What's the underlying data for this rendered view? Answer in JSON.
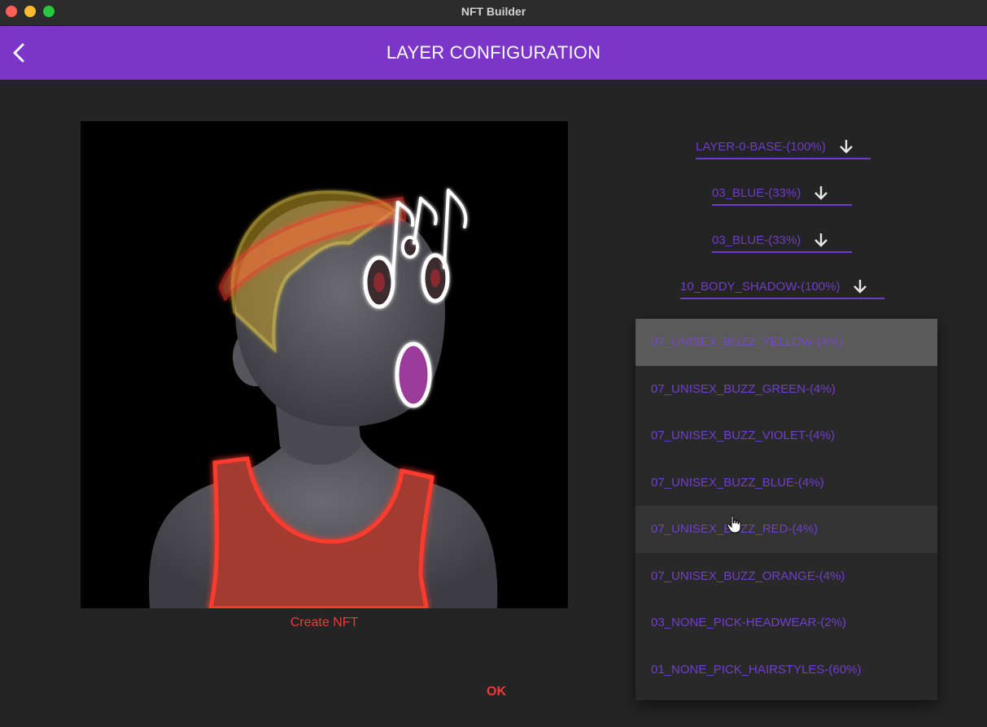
{
  "window": {
    "title": "NFT Builder"
  },
  "appbar": {
    "title": "LAYER CONFIGURATION",
    "back_icon": "chevron-left-icon"
  },
  "preview": {
    "action_label": "Create NFT"
  },
  "layers": [
    {
      "label": "LAYER-0-BASE-(100%)"
    },
    {
      "label": "03_BLUE-(33%)"
    },
    {
      "label": "03_BLUE-(33%)"
    },
    {
      "label": "10_BODY_SHADOW-(100%)"
    }
  ],
  "menu": {
    "items": [
      {
        "label": "07_UNISEX_BUZZ_YELLOW-(4%)",
        "state": "selected"
      },
      {
        "label": "07_UNISEX_BUZZ_GREEN-(4%)",
        "state": ""
      },
      {
        "label": "07_UNISEX_BUZZ_VIOLET-(4%)",
        "state": ""
      },
      {
        "label": "07_UNISEX_BUZZ_BLUE-(4%)",
        "state": ""
      },
      {
        "label": "07_UNISEX_BUZZ_RED-(4%)",
        "state": "hover"
      },
      {
        "label": "07_UNISEX_BUZZ_ORANGE-(4%)",
        "state": ""
      },
      {
        "label": "03_NONE_PICK-HEADWEAR-(2%)",
        "state": ""
      },
      {
        "label": "01_NONE_PICK_HAIRSTYLES-(60%)",
        "state": ""
      }
    ]
  },
  "footer": {
    "ok_label": "OK"
  },
  "colors": {
    "appbar": "#7b35c9",
    "accent_text": "#6d3cc4",
    "action_red": "#f03a3a",
    "background": "#242425"
  }
}
